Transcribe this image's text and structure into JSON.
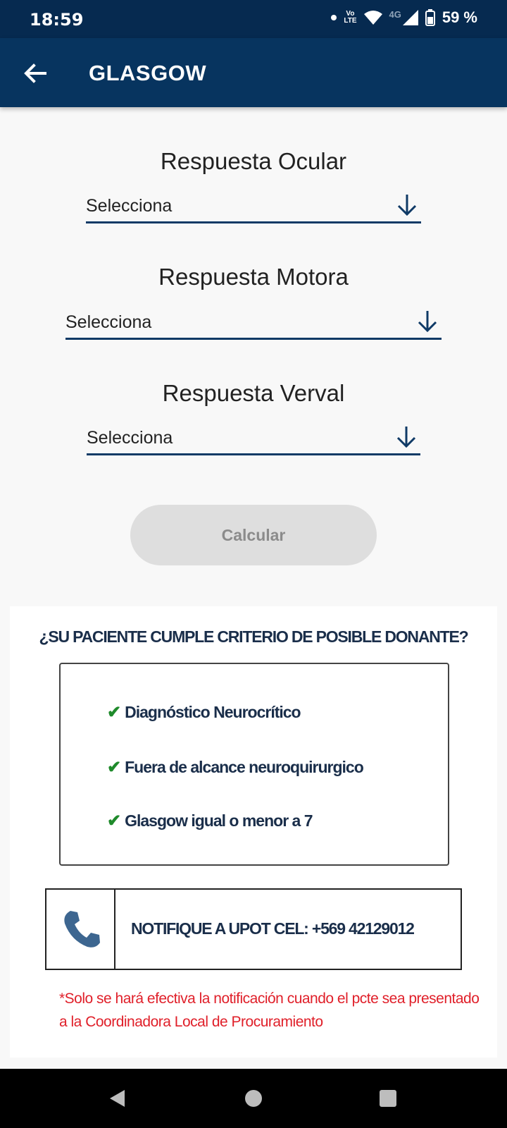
{
  "status_bar": {
    "time": "18:59",
    "battery": "59 %",
    "network": "4G",
    "volte": "Vo LTE"
  },
  "app_bar": {
    "title": "GLASGOW"
  },
  "fields": [
    {
      "label": "Respuesta Ocular",
      "value": "Selecciona"
    },
    {
      "label": "Respuesta Motora",
      "value": "Selecciona"
    },
    {
      "label": "Respuesta Verval",
      "value": "Selecciona"
    }
  ],
  "calculate_button": {
    "label": "Calcular"
  },
  "donor_card": {
    "question": "¿SU PACIENTE CUMPLE CRITERIO DE POSIBLE DONANTE?",
    "criteria": [
      "Diagnóstico Neurocrítico",
      "Fuera de alcance neuroquirurgico",
      "Glasgow igual o menor a 7"
    ],
    "notify_text": "NOTIFIQUE A UPOT CEL: +569 42129012",
    "note": "*Solo se hará efectiva la notificación cuando el pcte sea presentado a la Coordinadora Local de Procuramiento"
  },
  "icons": {
    "back": "arrow-left-icon",
    "dropdown": "arrow-down-icon",
    "check": "check-icon",
    "phone": "phone-icon"
  },
  "colors": {
    "primary": "#07345f",
    "status_bar": "#062a50",
    "note": "#e0202a",
    "check": "#1f8a2b"
  }
}
